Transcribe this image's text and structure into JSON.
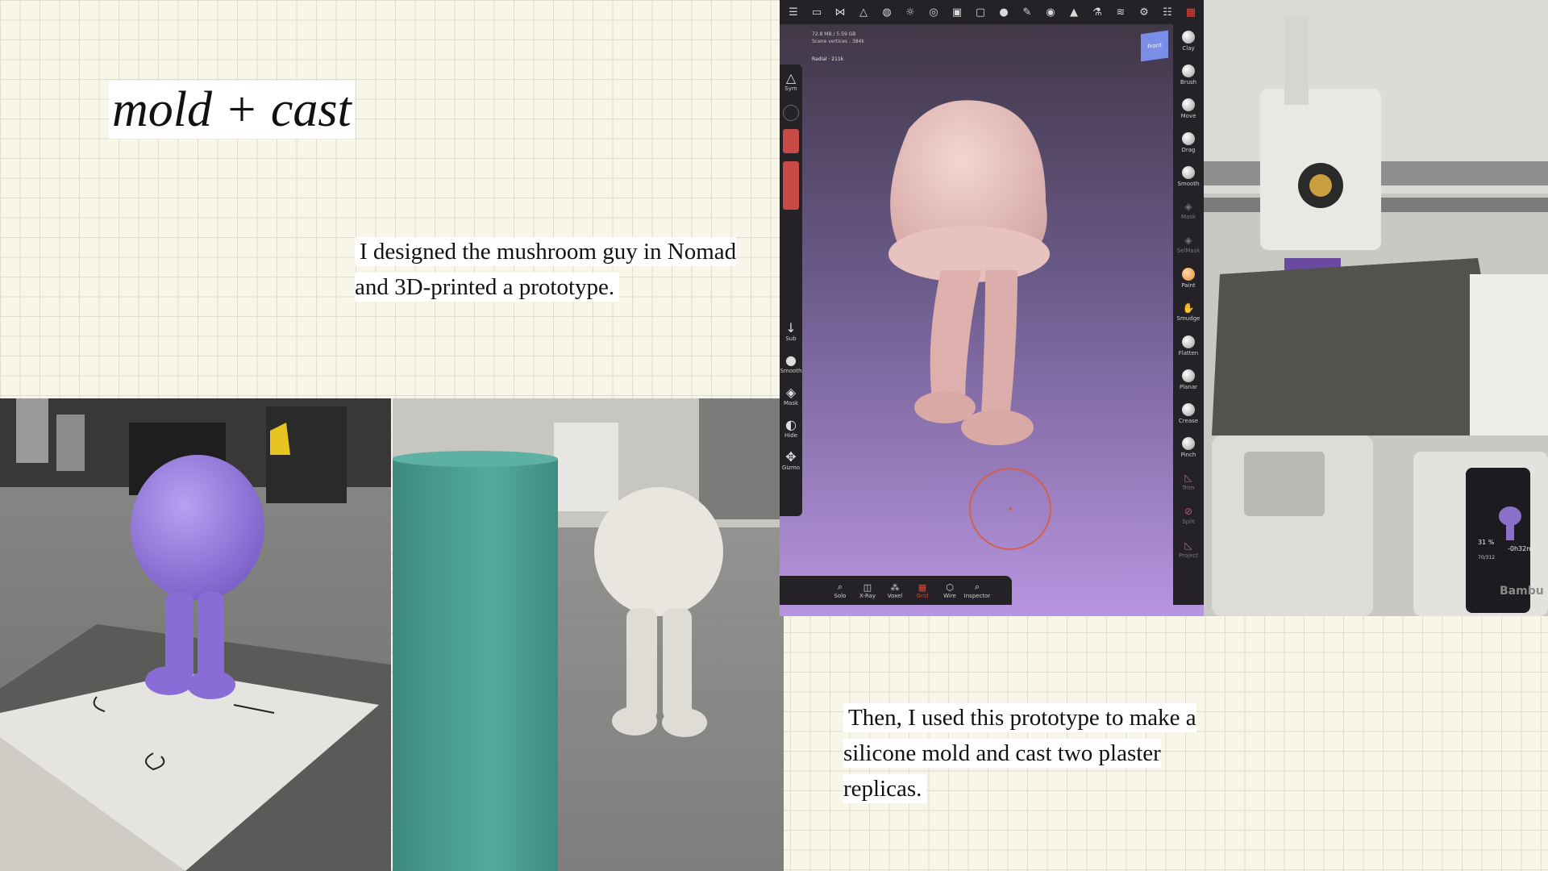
{
  "title": "mold + cast",
  "paragraph1": "I designed the mushroom guy in Nomad and 3D-printed a prototype.",
  "paragraph2": "Then, I used this prototype to make a silicone mold and cast two plaster replicas.",
  "nomad": {
    "info_line1": "72.8 MB / 5.59 GB",
    "info_line2": "Scene vertices : 384k",
    "radial": "Radial · 211k",
    "view_cube": "Front",
    "right_tools": [
      "Clay",
      "Brush",
      "Move",
      "Drag",
      "Smooth",
      "Mask",
      "SelMask",
      "Paint",
      "Smudge",
      "Flatten",
      "Planar",
      "Crease",
      "Pinch",
      "Trim",
      "Split",
      "Project"
    ],
    "left_tools": [
      "Sym",
      "Sub",
      "Smooth",
      "Mask",
      "Hide",
      "Gizmo"
    ],
    "bottom_tools": [
      "Solo",
      "X-Ray",
      "Voxel",
      "Grid",
      "Wire",
      "Inspector"
    ]
  },
  "printer_screen": {
    "progress": "31 %",
    "time_left": "-0h32m",
    "layers": "70/312",
    "brand": "Bambu"
  },
  "colors": {
    "background": "#f8f6e8",
    "grid": "#dcdccf",
    "purple_print": "#9a7ddc",
    "silicone_mold": "#4aa096",
    "plaster": "#e6e4dc"
  }
}
